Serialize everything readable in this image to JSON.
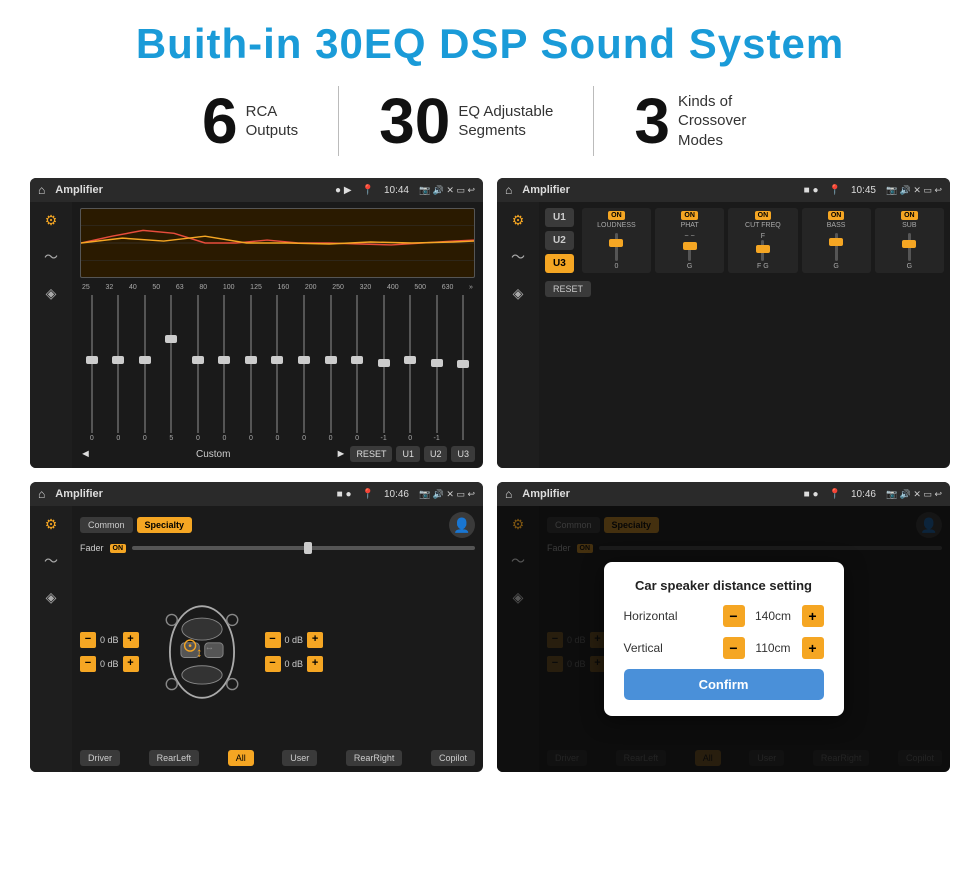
{
  "title": "Buith-in 30EQ DSP Sound System",
  "stats": [
    {
      "number": "6",
      "label": "RCA\nOutputs"
    },
    {
      "number": "30",
      "label": "EQ Adjustable\nSegments"
    },
    {
      "number": "3",
      "label": "Kinds of\nCrossover Modes"
    }
  ],
  "screen1": {
    "title": "Amplifier",
    "time": "10:44",
    "eq_frequencies": [
      "25",
      "32",
      "40",
      "50",
      "63",
      "80",
      "100",
      "125",
      "160",
      "200",
      "250",
      "320",
      "400",
      "500",
      "630"
    ],
    "eq_values": [
      "0",
      "0",
      "0",
      "5",
      "0",
      "0",
      "0",
      "0",
      "0",
      "0",
      "0",
      "-1",
      "0",
      "-1",
      ""
    ],
    "controls": {
      "prev": "◄",
      "label": "Custom",
      "next": "►",
      "reset": "RESET",
      "u1": "U1",
      "u2": "U2",
      "u3": "U3"
    }
  },
  "screen2": {
    "title": "Amplifier",
    "time": "10:45",
    "presets": [
      "U1",
      "U2",
      "U3"
    ],
    "params": [
      {
        "name": "LOUDNESS",
        "on": true
      },
      {
        "name": "PHAT",
        "on": true
      },
      {
        "name": "CUT FREQ",
        "on": true
      },
      {
        "name": "BASS",
        "on": true
      },
      {
        "name": "SUB",
        "on": true
      }
    ],
    "reset_label": "RESET"
  },
  "screen3": {
    "title": "Amplifier",
    "time": "10:46",
    "tabs": [
      "Common",
      "Specialty"
    ],
    "active_tab": "Specialty",
    "fader_label": "Fader",
    "fader_on": "ON",
    "db_values": [
      "0 dB",
      "0 dB",
      "0 dB",
      "0 dB"
    ],
    "locations": [
      "Driver",
      "RearLeft",
      "All",
      "User",
      "RearRight",
      "Copilot"
    ]
  },
  "screen4": {
    "title": "Amplifier",
    "time": "10:46",
    "tabs": [
      "Common",
      "Specialty"
    ],
    "dialog": {
      "title": "Car speaker distance setting",
      "horizontal_label": "Horizontal",
      "horizontal_value": "140cm",
      "vertical_label": "Vertical",
      "vertical_value": "110cm",
      "confirm_label": "Confirm",
      "right_db1": "0 dB",
      "right_db2": "0 dB"
    },
    "locations": [
      "Driver",
      "RearLeft",
      "All",
      "User",
      "RearRight",
      "Copilot"
    ]
  }
}
